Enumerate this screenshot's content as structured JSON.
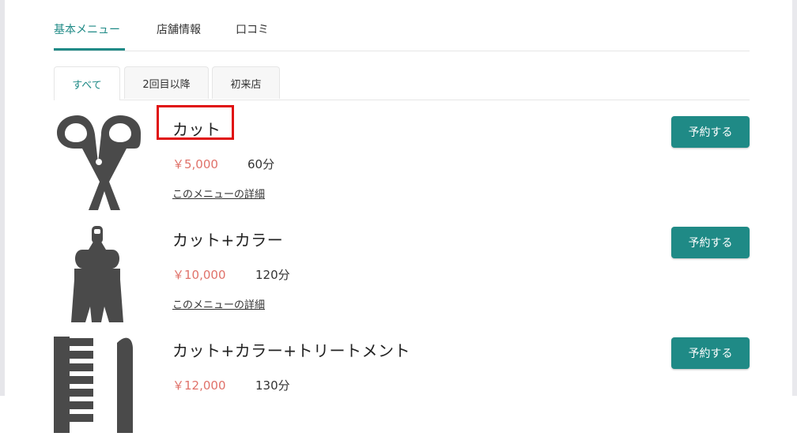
{
  "tabs": [
    {
      "label": "基本メニュー",
      "active": true
    },
    {
      "label": "店舗情報",
      "active": false
    },
    {
      "label": "口コミ",
      "active": false
    }
  ],
  "sub_tabs": [
    {
      "label": "すべて",
      "active": true
    },
    {
      "label": "2回目以降",
      "active": false
    },
    {
      "label": "初来店",
      "active": false
    }
  ],
  "menu_items": [
    {
      "icon": "scissors-icon",
      "name": "カット",
      "price": "￥5,000",
      "duration": "60分",
      "detail_link": "このメニューの詳細",
      "reserve_label": "予約する"
    },
    {
      "icon": "hair-dye-brush-icon",
      "name": "カット+カラー",
      "price": "￥10,000",
      "duration": "120分",
      "detail_link": "このメニューの詳細",
      "reserve_label": "予約する"
    },
    {
      "icon": "comb-icon",
      "name": "カット+カラー+トリートメント",
      "price": "￥12,000",
      "duration": "130分",
      "reserve_label": "予約する"
    }
  ],
  "colors": {
    "accent": "#1f8a86",
    "price": "#e0726a",
    "highlight": "#e01010"
  }
}
